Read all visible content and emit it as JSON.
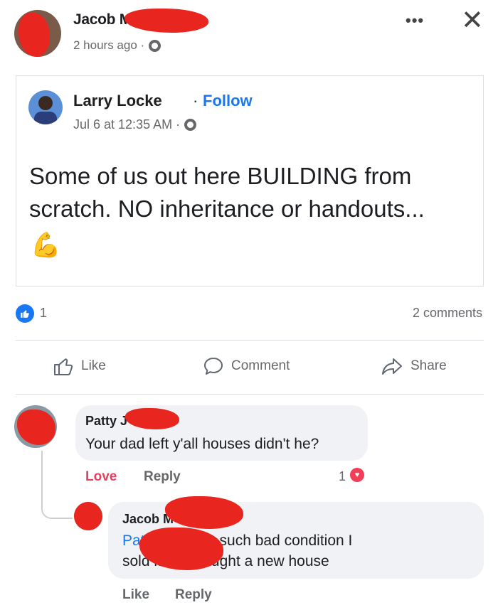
{
  "post": {
    "author_name": "Jacob M",
    "time": "2 hours ago ·",
    "more_label": "•••",
    "close_label": "✕"
  },
  "shared": {
    "author_name": "Larry Locke",
    "dot": "·",
    "follow_label": "Follow",
    "time": "Jul 6 at 12:35 AM ·",
    "text": "Some of us out here BUILDING from scratch. NO inheritance or handouts...",
    "emoji": "💪"
  },
  "reactions": {
    "like_icon": "like-icon",
    "count": "1",
    "comments": "2 comments"
  },
  "actions": {
    "like": "Like",
    "comment": "Comment",
    "share": "Share"
  },
  "comments": [
    {
      "author": "Patty J",
      "text": "Your dad left y'all houses didn't he?",
      "love_label": "Love",
      "reply_label": "Reply",
      "reaction_count": "1"
    },
    {
      "author": "Jacob M",
      "mention": "Patty",
      "text_part1": " It was in such bad condition I",
      "text_part2": "sold it and bought a new house",
      "like_label": "Like",
      "reply_label": "Reply"
    }
  ],
  "colors": {
    "accent": "#1877f2",
    "redaction": "#e8261f",
    "love": "#f33e58"
  }
}
